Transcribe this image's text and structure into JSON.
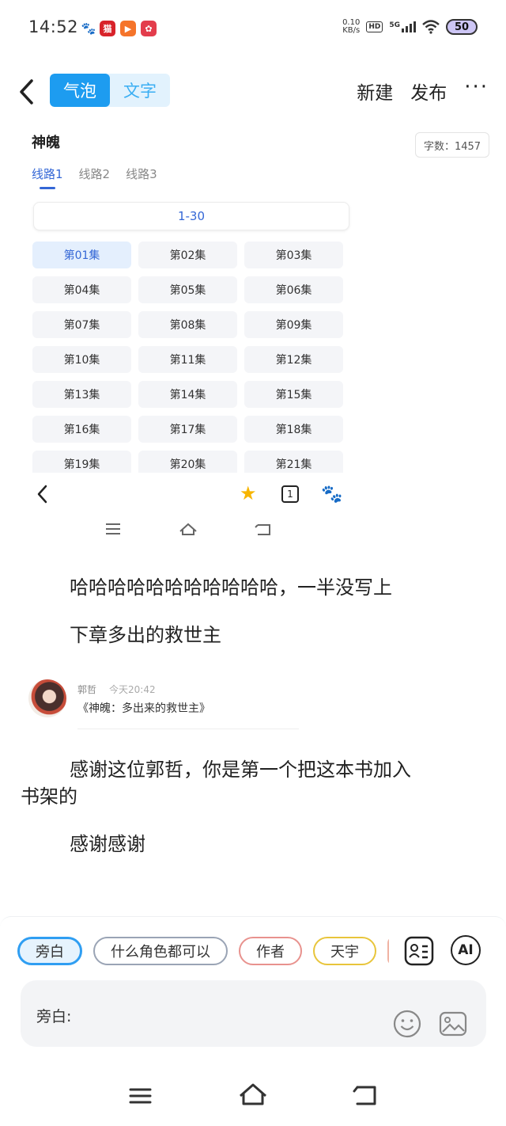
{
  "status_bar": {
    "time": "14:52",
    "network_speed_value": "0.10",
    "network_speed_unit": "KB/s",
    "hd_label": "HD",
    "network_type": "5G",
    "battery": "50",
    "app_icons": [
      "baidu-paw-icon",
      "tmall-icon",
      "video-app-icon",
      "red-app-icon"
    ]
  },
  "top_nav": {
    "tab_bubble": "气泡",
    "tab_text": "文字",
    "new_label": "新建",
    "publish_label": "发布",
    "more_label": "···"
  },
  "embedded_screen": {
    "book_title": "神魄",
    "word_count": "字数：1457",
    "routes": [
      "线路1",
      "线路2",
      "线路3"
    ],
    "range_label": "1-30",
    "episodes": [
      "第01集",
      "第02集",
      "第03集",
      "第04集",
      "第05集",
      "第06集",
      "第07集",
      "第08集",
      "第09集",
      "第10集",
      "第11集",
      "第12集",
      "第13集",
      "第14集",
      "第15集",
      "第16集",
      "第17集",
      "第18集",
      "第19集",
      "第20集",
      "第21集"
    ],
    "bookmark_count": "1"
  },
  "story": {
    "para1": "哈哈哈哈哈哈哈哈哈哈哈，一半没写上",
    "para2": "下章多出的救世主",
    "para3_line1": "感谢这位郭哲，你是第一个把这本书加入",
    "para3_line2": "书架的",
    "para4": "感谢感谢"
  },
  "comment": {
    "username": "郭哲",
    "time": "今天20:42",
    "text": "《神魄：多出来的救世主》"
  },
  "composer": {
    "chips": [
      "旁白",
      "什么角色都可以",
      "作者",
      "天宇"
    ],
    "input_prefix": "旁白:",
    "ai_label": "AI"
  }
}
